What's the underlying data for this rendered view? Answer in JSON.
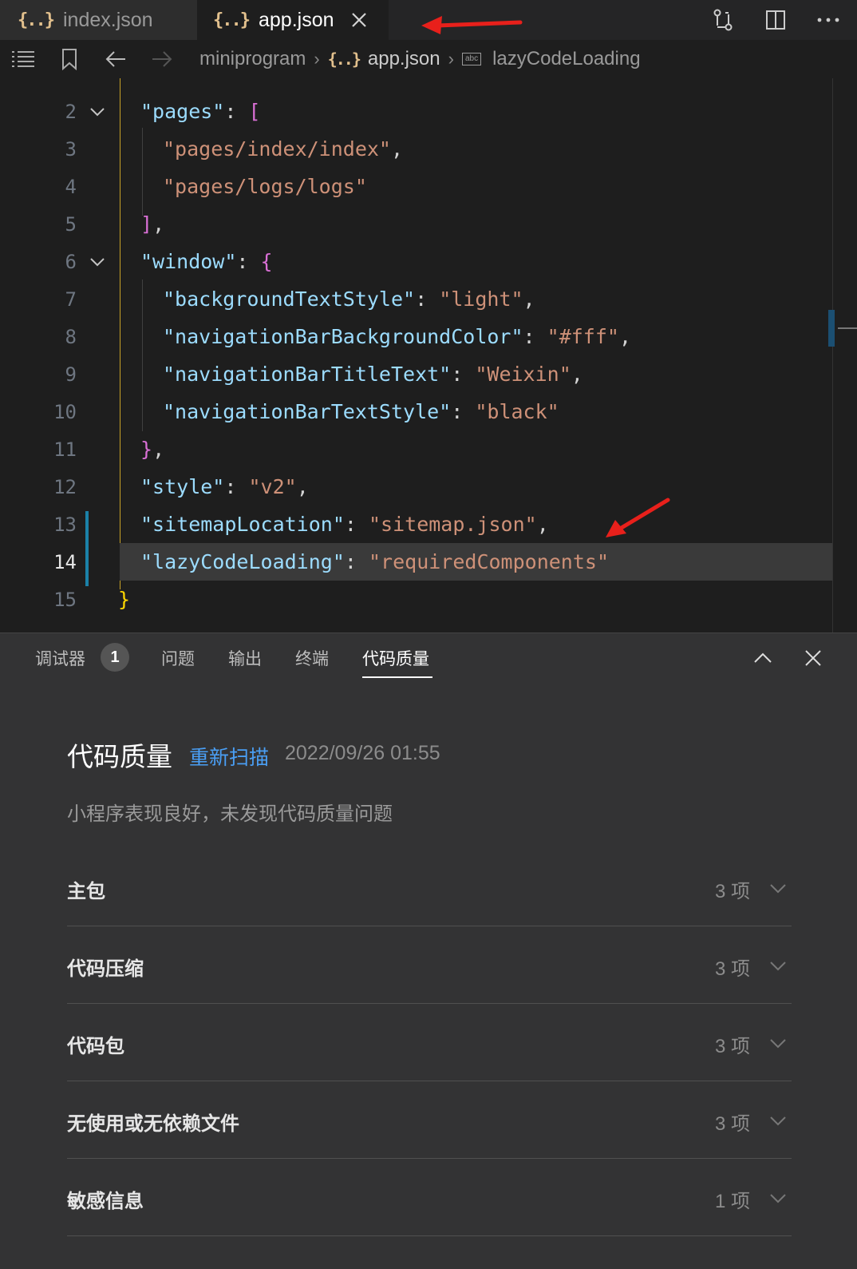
{
  "tabs": [
    {
      "icon": "{..}",
      "label": "index.json"
    },
    {
      "icon": "{..}",
      "label": "app.json"
    }
  ],
  "breadcrumb": {
    "root": "miniprogram",
    "json_icon": "{..}",
    "file": "app.json",
    "abc_icon": "abc",
    "symbol": "lazyCodeLoading"
  },
  "editor": {
    "current_line": 14,
    "lines": [
      {
        "n": "2"
      },
      {
        "n": "3"
      },
      {
        "n": "4"
      },
      {
        "n": "5"
      },
      {
        "n": "6"
      },
      {
        "n": "7"
      },
      {
        "n": "8"
      },
      {
        "n": "9"
      },
      {
        "n": "10"
      },
      {
        "n": "11"
      },
      {
        "n": "12"
      },
      {
        "n": "13"
      },
      {
        "n": "14"
      },
      {
        "n": "15"
      }
    ],
    "tokens": {
      "pages_key": "\"pages\"",
      "page1": "\"pages/index/index\"",
      "page2": "\"pages/logs/logs\"",
      "window_key": "\"window\"",
      "bts_key": "\"backgroundTextStyle\"",
      "bts_val": "\"light\"",
      "nbbc_key": "\"navigationBarBackgroundColor\"",
      "nbbc_val": "\"#fff\"",
      "nbtt_key": "\"navigationBarTitleText\"",
      "nbtt_val": "\"Weixin\"",
      "nbts_key": "\"navigationBarTextStyle\"",
      "nbts_val": "\"black\"",
      "style_key": "\"style\"",
      "style_val": "\"v2\"",
      "sitemap_key": "\"sitemapLocation\"",
      "sitemap_val": "\"sitemap.json\"",
      "lazy_key": "\"lazyCodeLoading\"",
      "lazy_val": "\"requiredComponents\""
    }
  },
  "panel": {
    "tabs": [
      "调试器",
      "问题",
      "输出",
      "终端",
      "代码质量"
    ],
    "debugger_badge": "1",
    "active_tab": "代码质量",
    "title": "代码质量",
    "rescan": "重新扫描",
    "time": "2022/09/26 01:55",
    "description": "小程序表现良好，未发现代码质量问题",
    "categories": [
      {
        "label": "主包",
        "count": "3 项"
      },
      {
        "label": "代码压缩",
        "count": "3 项"
      },
      {
        "label": "代码包",
        "count": "3 项"
      },
      {
        "label": "无使用或无依赖文件",
        "count": "3 项"
      },
      {
        "label": "敏感信息",
        "count": "1 项"
      }
    ]
  },
  "colors": {
    "key": "#9cdcfe",
    "string": "#ce9178",
    "link": "#4a9ff5",
    "annotation_arrow": "#e8201b"
  }
}
